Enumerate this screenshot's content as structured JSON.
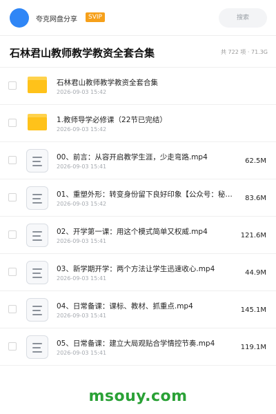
{
  "header": {
    "brand": "夸克网盘分享",
    "badge": "SVIP",
    "search_placeholder": "搜索",
    "avatar_color": "#2f86f6"
  },
  "folder": {
    "title": "石林君山教师教学教资全套合集",
    "summary": "共 722 项 · 71.3G"
  },
  "items": [
    {
      "type": "folder",
      "icon": "folder-icon",
      "name": "石林君山教师教学教资全套合集",
      "date": "2026-09-03 15:42",
      "size": ""
    },
    {
      "type": "folder",
      "icon": "folder-icon",
      "name": "1.教师导学必修课（22节已完结）",
      "date": "2026-09-03 15:42",
      "size": ""
    },
    {
      "type": "video",
      "icon": "video-file-icon",
      "name": "00、前言：从容开启教学生涯，少走弯路.mp4",
      "date": "2026-09-03 15:41",
      "size": "62.5M"
    },
    {
      "type": "video",
      "icon": "video-file-icon",
      "name": "01、重塑外形：转变身份留下良好印象【公众号：秘知…",
      "date": "2026-09-03 15:42",
      "size": "83.6M"
    },
    {
      "type": "video",
      "icon": "video-file-icon",
      "name": "02、开学第一课：用这个模式简单又权威.mp4",
      "date": "2026-09-03 15:41",
      "size": "121.6M"
    },
    {
      "type": "video",
      "icon": "video-file-icon",
      "name": "03、新学期开学：两个方法让学生迅速收心.mp4",
      "date": "2026-09-03 15:41",
      "size": "44.9M"
    },
    {
      "type": "video",
      "icon": "video-file-icon",
      "name": "04、日常备课：课标、教材、抓重点.mp4",
      "date": "2026-09-03 15:41",
      "size": "145.1M"
    },
    {
      "type": "video",
      "icon": "video-file-icon",
      "name": "05、日常备课：建立大局观贴合学情控节奏.mp4",
      "date": "2026-09-03 15:41",
      "size": "119.1M"
    }
  ],
  "footer": {
    "watermark": "msouy.com",
    "color": "#2aa136"
  },
  "colors": {
    "accent": "#2f86f6",
    "badge": "#f6a01a",
    "folder": "#ffc21a"
  }
}
